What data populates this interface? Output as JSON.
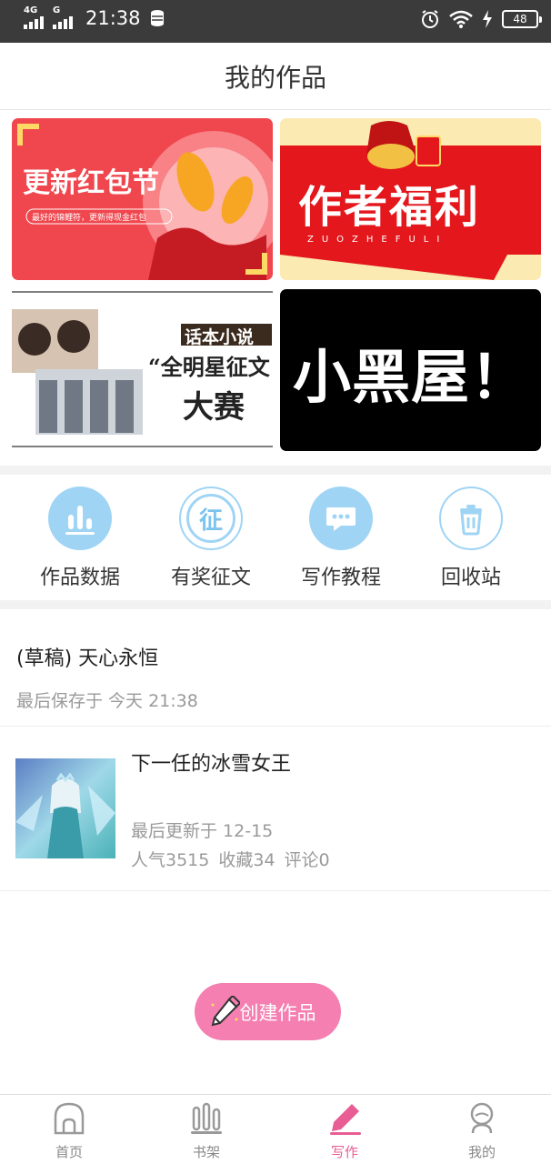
{
  "status_bar": {
    "network1": "4G",
    "network2": "G",
    "time": "21:38",
    "battery": "48"
  },
  "header": {
    "title": "我的作品"
  },
  "banners": [
    {
      "title": "更新红包节",
      "subtitle": "最好的锦鲤符，更新得现金红包"
    },
    {
      "title": "作者福利",
      "subtitle": "ZUOZHEFULI"
    },
    {
      "title_top": "话本小说",
      "title_mid": "“全明星征文",
      "title_bottom": "大赛"
    },
    {
      "title": "小黑屋！"
    }
  ],
  "quick_actions": [
    {
      "label": "作品数据",
      "icon": "bar-chart-icon"
    },
    {
      "label": "有奖征文",
      "icon": "contest-icon",
      "glyph": "征"
    },
    {
      "label": "写作教程",
      "icon": "chat-bubble-icon"
    },
    {
      "label": "回收站",
      "icon": "trash-icon"
    }
  ],
  "draft": {
    "title": "(草稿) 天心永恒",
    "meta": "最后保存于 今天 21:38"
  },
  "work": {
    "title": "下一任的冰雪女王",
    "updated": "最后更新于 12-15",
    "popularity": "人气3515",
    "favorites": "收藏34",
    "comments": "评论0"
  },
  "create_button": {
    "label": "创建作品"
  },
  "tabs": [
    {
      "label": "首页",
      "icon": "home-icon"
    },
    {
      "label": "书架",
      "icon": "bookshelf-icon"
    },
    {
      "label": "写作",
      "icon": "pencil-icon"
    },
    {
      "label": "我的",
      "icon": "profile-icon"
    }
  ],
  "colors": {
    "accent_pink": "#e85d93",
    "create_button": "#f47fb0",
    "action_blue": "#9fd4f5"
  }
}
